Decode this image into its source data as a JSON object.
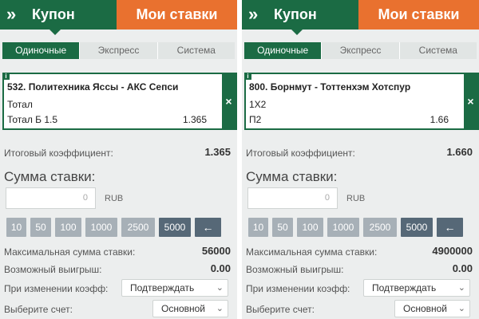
{
  "header": {
    "back_icon": "double-chevron-right-icon",
    "coupon_label": "Купон",
    "my_bets_label": "Мои ставки",
    "coupon_color": "#1b6b44",
    "my_bets_color": "#e9712f"
  },
  "tabs": [
    {
      "label": "Одиночные",
      "active": true
    },
    {
      "label": "Экспресс",
      "active": false
    },
    {
      "label": "Система",
      "active": false
    }
  ],
  "labels": {
    "total_coef": "Итоговый коэффициент:",
    "stake_title": "Сумма ставки:",
    "currency": "RUB",
    "max_stake": "Максимальная сумма ставки:",
    "possible_win": "Возможный выигрыш:",
    "on_coef_change": "При изменении коэфф:",
    "choose_account": "Выберите счет:",
    "info_icon_text": "i",
    "close_icon_text": "×",
    "arrow_icon_text": "←",
    "dropdown_icon_text": "⌄"
  },
  "chips": [
    "10",
    "50",
    "100",
    "1000",
    "2500",
    "5000"
  ],
  "panels": [
    {
      "bet_title": "532. Политехника Яссы - АКС Сепси",
      "market": "Тотал",
      "outcome": "Тотал Б 1.5",
      "odds": "1.365",
      "total_coef": "1.365",
      "stake_value": "0",
      "max_stake": "56000",
      "possible_win": "0.00",
      "coef_change_option": "Подтверждать",
      "account_option": "Основной"
    },
    {
      "bet_title": "800. Борнмут - Тоттенхэм Хотспур",
      "market": "1X2",
      "outcome": "П2",
      "odds": "1.66",
      "total_coef": "1.660",
      "stake_value": "0",
      "max_stake": "4900000",
      "possible_win": "0.00",
      "coef_change_option": "Подтверждать",
      "account_option": "Основной"
    }
  ]
}
